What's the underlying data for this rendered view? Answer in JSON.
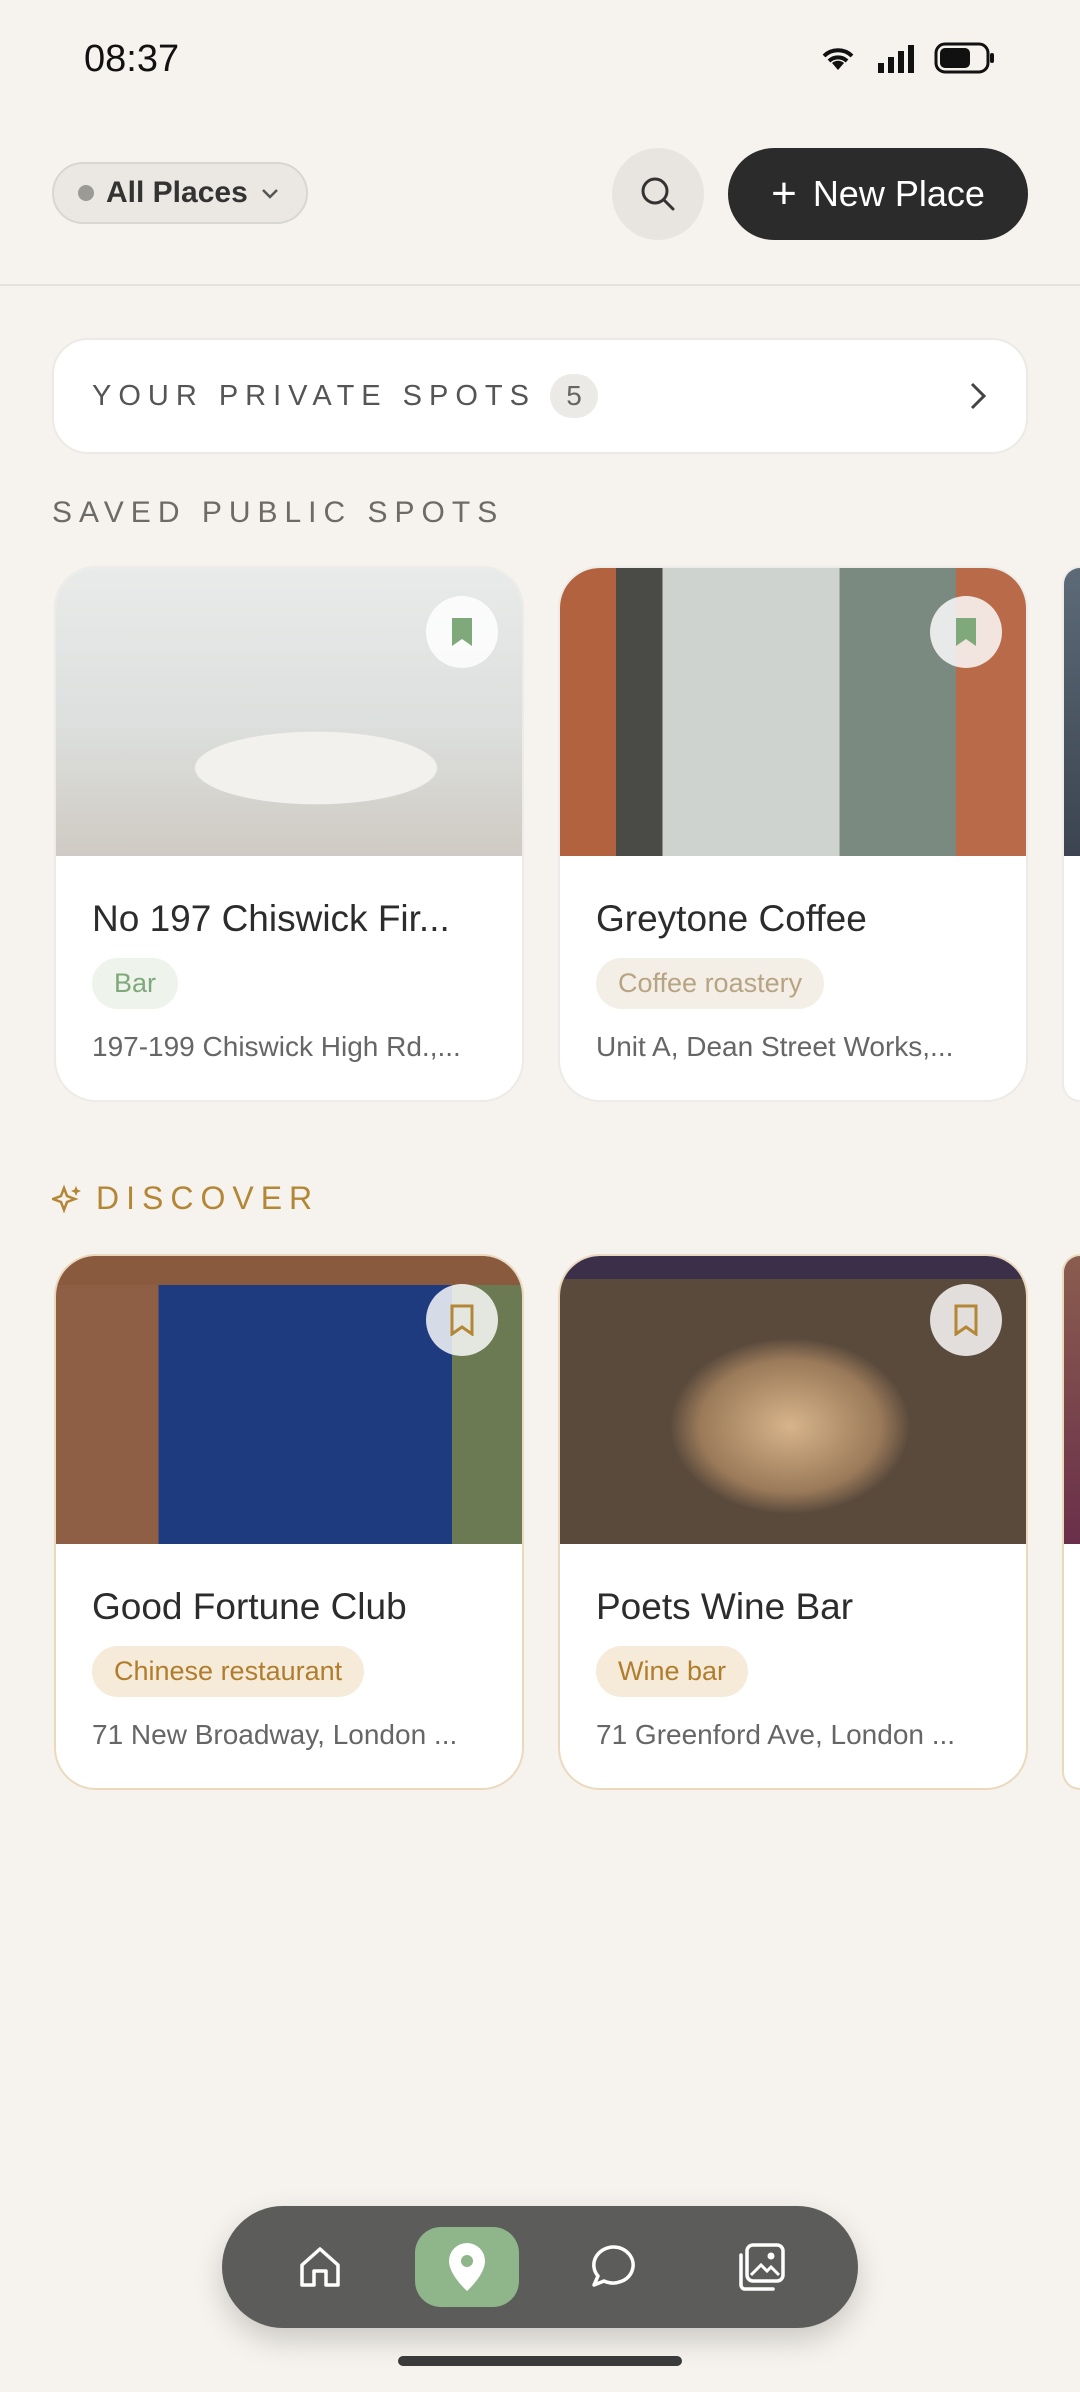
{
  "status_bar": {
    "time": "08:37"
  },
  "header": {
    "filter_label": "All Places",
    "new_place_label": "New Place"
  },
  "private_spots": {
    "title": "YOUR PRIVATE SPOTS",
    "count": "5"
  },
  "saved_public": {
    "title": "SAVED PUBLIC SPOTS",
    "cards": [
      {
        "title": "No 197 Chiswick Fir...",
        "tag": "Bar",
        "address": "197-199 Chiswick High Rd.,..."
      },
      {
        "title": "Greytone Coffee",
        "tag": "Coffee roastery",
        "address": "Unit A, Dean Street Works,..."
      }
    ]
  },
  "discover": {
    "title": "DISCOVER",
    "cards": [
      {
        "title": "Good Fortune Club",
        "tag": "Chinese restaurant",
        "address": "71 New Broadway, London ..."
      },
      {
        "title": "Poets Wine Bar",
        "tag": "Wine bar",
        "address": "71 Greenford Ave, London ..."
      }
    ]
  },
  "bottom_nav": {
    "items": [
      "home-icon",
      "map-pin-icon",
      "chat-bubble-icon",
      "gallery-icon"
    ],
    "active": "map-pin-icon",
    "accent": "#8fb58a"
  },
  "colors": {
    "primary_button": "#2b2b2b",
    "discover_accent": "#b48737",
    "background": "#f6f3ee"
  }
}
